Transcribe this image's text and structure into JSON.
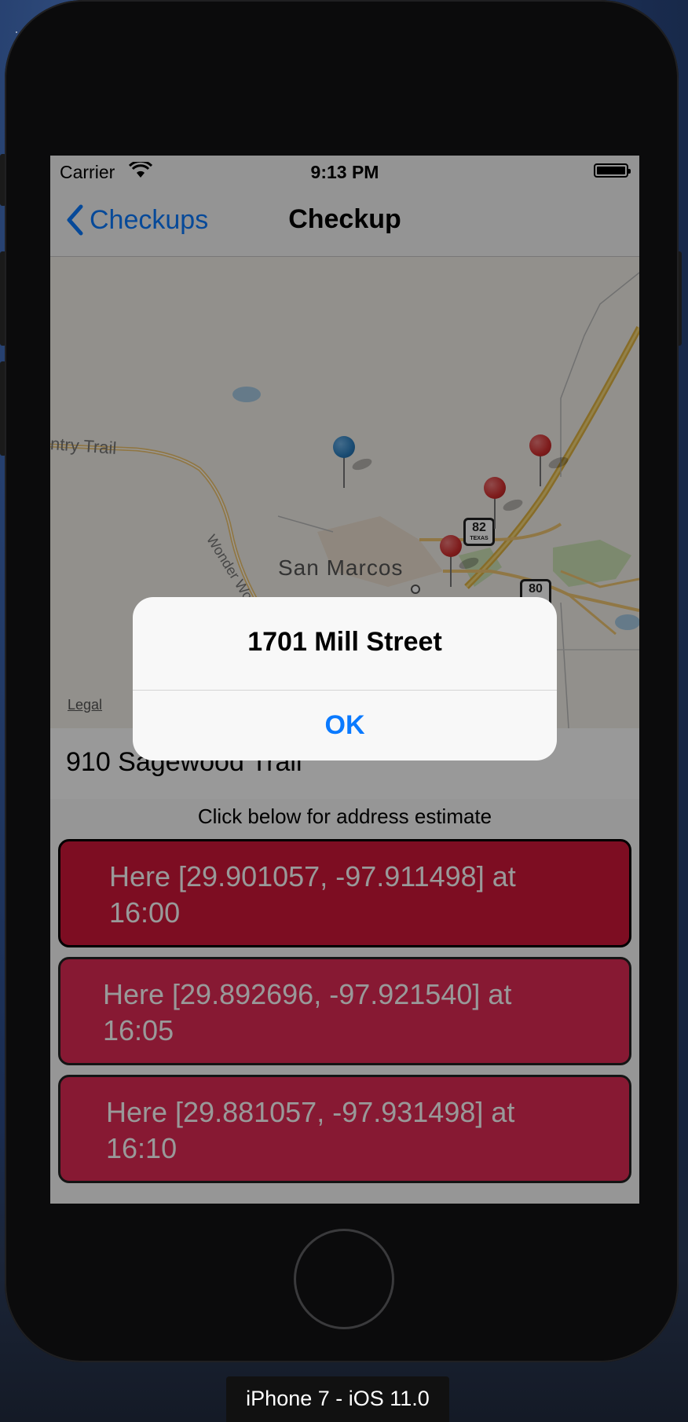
{
  "statusbar": {
    "carrier": "Carrier",
    "time": "9:13 PM"
  },
  "navbar": {
    "back_label": "Checkups",
    "title": "Checkup"
  },
  "map": {
    "city_label": "San Marcos",
    "road_labels": [
      "ntry Trail",
      "Wonder World"
    ],
    "highway_shields": [
      {
        "number": "82",
        "state": "TEXAS"
      },
      {
        "number": "80",
        "state": ""
      }
    ],
    "legal_label": "Legal",
    "pin_colors": {
      "current": "#2c7fc0",
      "checkup": "#d32f2f"
    }
  },
  "address_row": {
    "text": "910 Sagewood Trail"
  },
  "hint": "Click below for address estimate",
  "checkups": [
    {
      "text": "Here [29.901057, -97.911498] at 16:00",
      "selected": true
    },
    {
      "text": "Here [29.892696, -97.921540] at 16:05",
      "selected": false
    },
    {
      "text": "Here [29.881057, -97.931498] at 16:10",
      "selected": false
    }
  ],
  "alert": {
    "title": "1701 Mill Street",
    "ok_label": "OK"
  },
  "device_label": "iPhone 7 - iOS 11.0",
  "colors": {
    "accent": "#0a7aff",
    "checkup_fill": "#e12b56",
    "checkup_selected_fill": "#d1173a"
  }
}
